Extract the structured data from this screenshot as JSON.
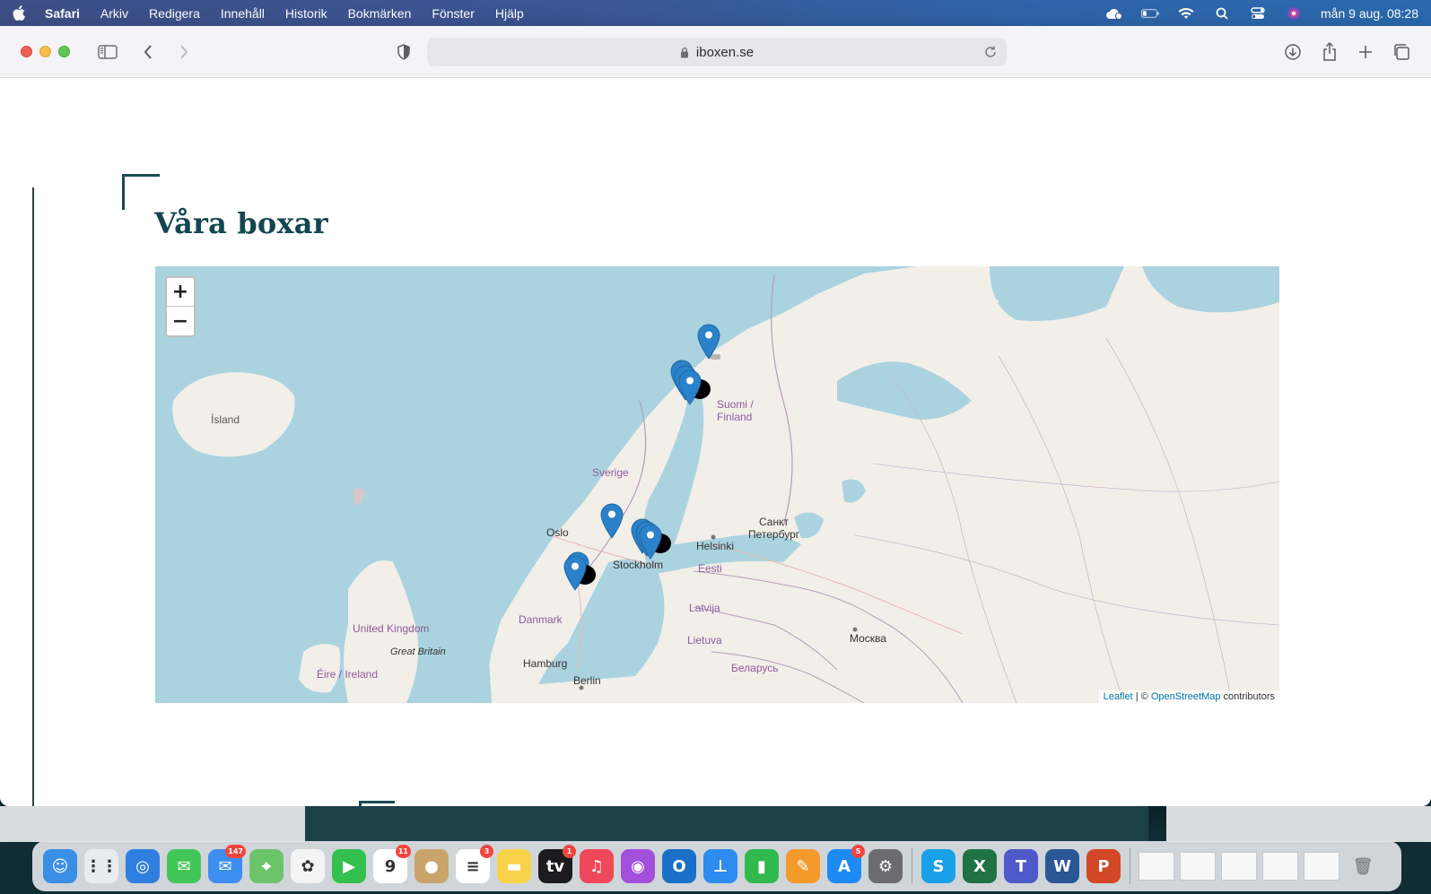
{
  "menubar": {
    "app": "Safari",
    "items": [
      "Arkiv",
      "Redigera",
      "Innehåll",
      "Historik",
      "Bokmärken",
      "Fönster",
      "Hjälp"
    ],
    "clock": "mån 9 aug. 08:28"
  },
  "browser": {
    "url": "iboxen.se"
  },
  "page": {
    "heading": "Våra boxar"
  },
  "map": {
    "zoom_in": "+",
    "zoom_out": "−",
    "attribution": {
      "leaflet": "Leaflet",
      "separator": " | © ",
      "osm": "OpenStreetMap",
      "suffix": " contributors"
    },
    "labels": {
      "island": "Ísland",
      "suomi": "Suomi /",
      "finland": "Finland",
      "sverige": "Sverige",
      "oslo": "Oslo",
      "stockholm": "Stockholm",
      "helsinki": "Helsinki",
      "spb1": "Санкт",
      "spb2": "Петербург",
      "eesti": "Eesti",
      "latvija": "Latvija",
      "lietuva": "Lietuva",
      "danmark": "Danmark",
      "uk": "United Kingdom",
      "gb": "Great Britain",
      "eire": "Éire / Ireland",
      "hamburg": "Hamburg",
      "berlin": "Berlin",
      "moskva": "Москва",
      "belarus": "Беларусь"
    },
    "marker_color": "#2b82cb"
  },
  "dock": {
    "apps": [
      {
        "name": "finder",
        "glyph": "☺",
        "color": "#3a8ee6"
      },
      {
        "name": "launchpad",
        "glyph": "⋮⋮",
        "color": "#e9ecef"
      },
      {
        "name": "safari",
        "glyph": "◎",
        "color": "#2f7fe0"
      },
      {
        "name": "messages",
        "glyph": "✉",
        "color": "#43c658"
      },
      {
        "name": "mail",
        "glyph": "✉",
        "color": "#3d8ef0",
        "badge": "147"
      },
      {
        "name": "maps",
        "glyph": "⌖",
        "color": "#6cc46a"
      },
      {
        "name": "photos",
        "glyph": "✿",
        "color": "#f4f4f4"
      },
      {
        "name": "facetime",
        "glyph": "▶",
        "color": "#34c04f"
      },
      {
        "name": "calendar",
        "glyph": "9",
        "color": "#ffffff",
        "badge": "11"
      },
      {
        "name": "contacts",
        "glyph": "●",
        "color": "#c9a46b"
      },
      {
        "name": "reminders",
        "glyph": "≡",
        "color": "#ffffff",
        "badge": "3"
      },
      {
        "name": "notes",
        "glyph": "▬",
        "color": "#f8d34a"
      },
      {
        "name": "tv",
        "glyph": "tv",
        "color": "#1c1c1e",
        "badge": "1"
      },
      {
        "name": "music",
        "glyph": "♫",
        "color": "#f0485b"
      },
      {
        "name": "podcasts",
        "glyph": "◉",
        "color": "#a24fd9"
      },
      {
        "name": "outlook",
        "glyph": "O",
        "color": "#1870c8"
      },
      {
        "name": "keynote",
        "glyph": "⊥",
        "color": "#2d8cf0"
      },
      {
        "name": "numbers",
        "glyph": "▮",
        "color": "#30b94d"
      },
      {
        "name": "pages",
        "glyph": "✎",
        "color": "#f39a2b"
      },
      {
        "name": "appstore",
        "glyph": "A",
        "color": "#1e8af3",
        "badge": "5"
      },
      {
        "name": "systemprefs",
        "glyph": "⚙",
        "color": "#6c6c70"
      }
    ],
    "apps2": [
      {
        "name": "skype",
        "glyph": "S",
        "color": "#1aa0e8"
      },
      {
        "name": "excel",
        "glyph": "X",
        "color": "#1f7244"
      },
      {
        "name": "teams",
        "glyph": "T",
        "color": "#5059c9"
      },
      {
        "name": "word",
        "glyph": "W",
        "color": "#2b5797"
      },
      {
        "name": "powerpoint",
        "glyph": "P",
        "color": "#d24726"
      }
    ]
  }
}
